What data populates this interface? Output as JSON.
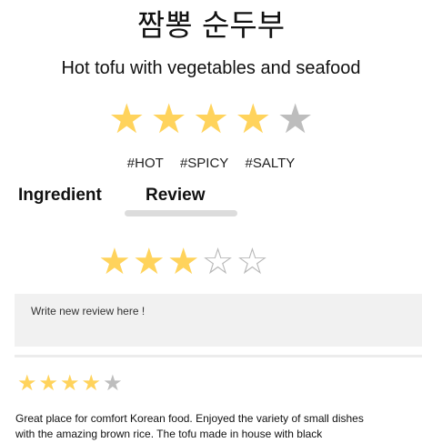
{
  "dish": {
    "name_korean": "짬뽕 순두부",
    "description": "Hot tofu with vegetables and seafood"
  },
  "overall_rating": {
    "value": 4,
    "max": 5
  },
  "tags": [
    "#HOT",
    "#SPICY",
    "#SALTY"
  ],
  "tabs": [
    {
      "label": "Ingredient",
      "active": false
    },
    {
      "label": "Review",
      "active": true
    }
  ],
  "new_review": {
    "rating": 3,
    "max": 5,
    "placeholder": "Write new review here !"
  },
  "reviews": [
    {
      "rating": 4,
      "max": 5,
      "text_line1": "Great place for comfort Korean food. Enjoyed the variety of small dishes",
      "text_line2": "with the amazing brown rice. The tofu made in house with black"
    }
  ],
  "colors": {
    "star_filled": "#ffd35c",
    "star_empty": "#bdbdbd",
    "input_bg": "#f1f1f1",
    "tab_underline": "#dcdcdc"
  },
  "icons": {
    "filled_star": "star-filled-icon",
    "empty_star": "star-empty-icon",
    "outline_star": "star-outline-icon"
  }
}
